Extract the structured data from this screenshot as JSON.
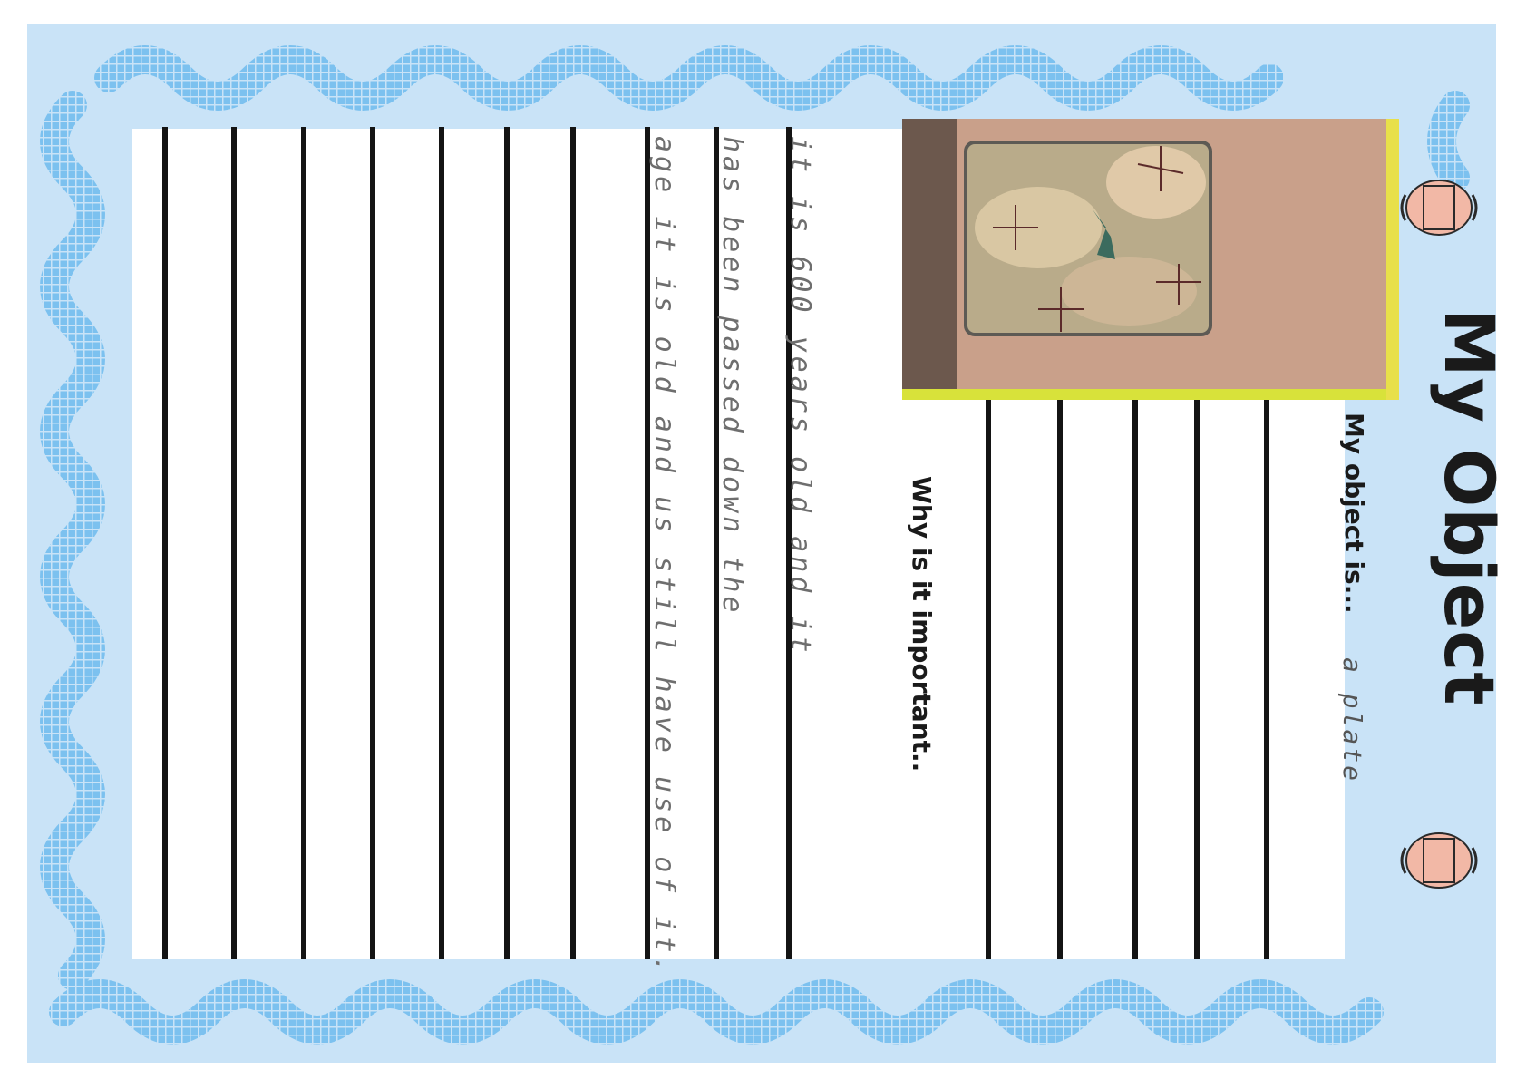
{
  "worksheet": {
    "title": "My Object",
    "object_label": "My object is...",
    "object_answer": "a plate",
    "question": "Why is it important..",
    "handwritten_lines": [
      "it is 600 years old and it",
      "has been passed down the",
      "age it is old and us still have use of it."
    ]
  },
  "icons": {
    "jar_top": "amphora-icon",
    "jar_bottom": "amphora-icon"
  },
  "colors": {
    "border_background": "#c9e3f7",
    "mosaic_tile": "#7cc1ef",
    "rule": "#141414",
    "title": "#1a1a1a"
  }
}
